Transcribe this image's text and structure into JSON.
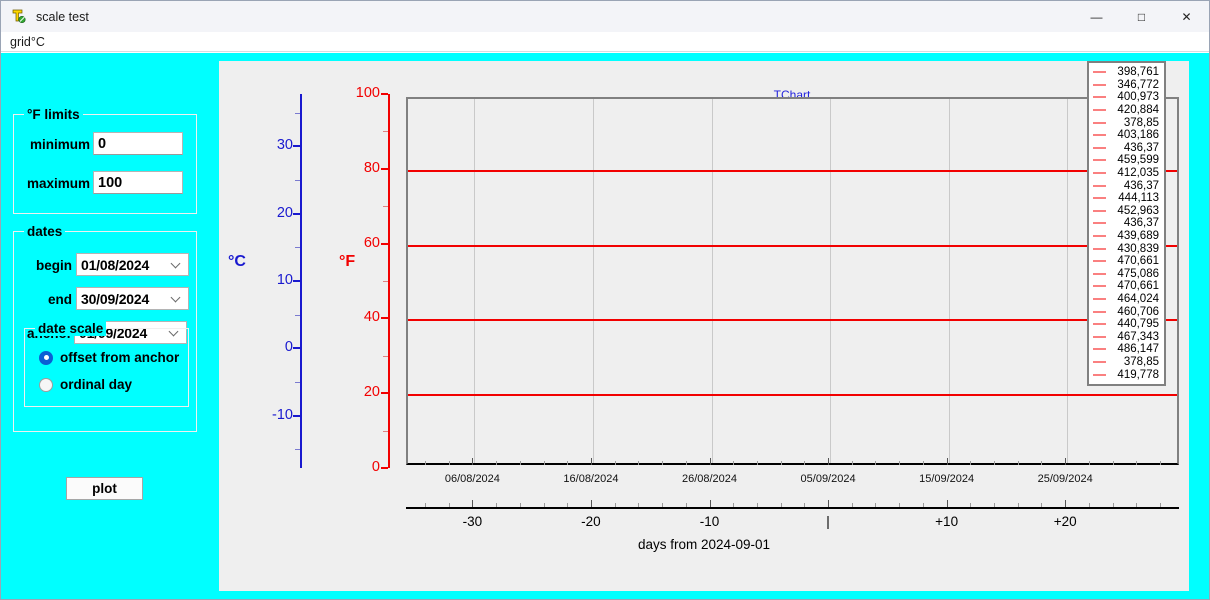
{
  "window": {
    "title": "scale test",
    "icon": "app-icon",
    "controls": {
      "minimize": "—",
      "maximize": "□",
      "close": "✕"
    }
  },
  "menubar": {
    "items": [
      {
        "accel": "g",
        "rest": "rid°C",
        "full": "grid°C"
      }
    ]
  },
  "panel": {
    "flimits": {
      "caption": "°F limits",
      "minimum_label": "minimum",
      "minimum_value": "0",
      "maximum_label": "maximum",
      "maximum_value": "100"
    },
    "dates": {
      "caption": "dates",
      "begin_label": "begin",
      "begin_value": "01/08/2024",
      "end_label": "end",
      "end_value": "30/09/2024",
      "anchor_label": "anchor",
      "anchor_value": "01/09/2024",
      "datescale": {
        "caption": "date scale",
        "options": [
          {
            "label": "offset from anchor",
            "checked": true
          },
          {
            "label": "ordinal day",
            "checked": false
          }
        ]
      }
    },
    "plot_button": "plot"
  },
  "chart_data": {
    "type": "line",
    "title": "TChart",
    "xlabel": "days from 2024-09-01",
    "ylabel_left": "°C",
    "ylabel_right": "°F",
    "grid": true,
    "legend_position": "top-right",
    "axes": {
      "celsius": {
        "caption": "°C",
        "color": "#1919cf",
        "ticks": [
          -10,
          0,
          10,
          20,
          30
        ],
        "tick_labels": [
          "-10",
          "0",
          "10",
          "20",
          "30"
        ],
        "range": [
          -17.8,
          37.8
        ]
      },
      "fahrenheit": {
        "caption": "°F",
        "color": "#f20000",
        "ticks": [
          0,
          20,
          40,
          60,
          80,
          100
        ],
        "tick_labels": [
          "0",
          "20",
          "40",
          "60",
          "80",
          "100"
        ],
        "range": [
          0,
          100
        ]
      },
      "date": {
        "tick_labels": [
          "06/08/2024",
          "16/08/2024",
          "26/08/2024",
          "05/09/2024",
          "15/09/2024",
          "25/09/2024"
        ]
      },
      "offset": {
        "title": "days from 2024-09-01",
        "tick_labels": [
          "-30",
          "-20",
          "-10",
          "|",
          "+10",
          "+20"
        ],
        "values": [
          -30,
          -20,
          -10,
          0,
          10,
          20
        ]
      }
    },
    "gridlines_fahrenheit": [
      20,
      40,
      60,
      80
    ],
    "legend": {
      "values": [
        "398,761",
        "346,772",
        "400,973",
        "420,884",
        "378,85",
        "403,186",
        "436,37",
        "459,599",
        "412,035",
        "436,37",
        "444,113",
        "452,963",
        "436,37",
        "439,689",
        "430,839",
        "470,661",
        "475,086",
        "470,661",
        "464,024",
        "460,706",
        "440,795",
        "467,343",
        "486,147",
        "378,85",
        "419,778"
      ],
      "marker_color": "#fa8080"
    }
  }
}
